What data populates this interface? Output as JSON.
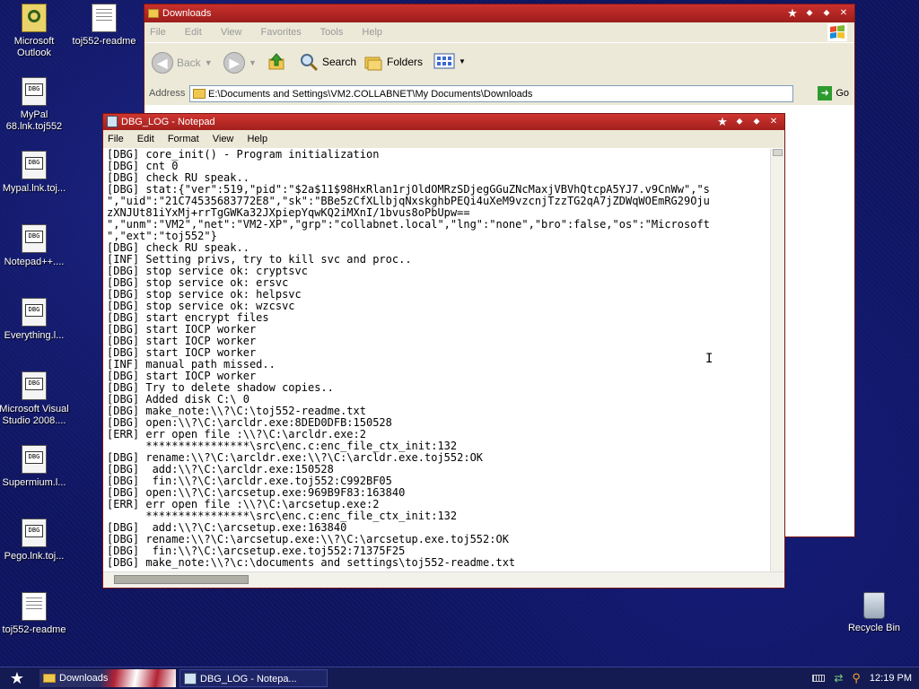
{
  "desktop": {
    "icons": [
      {
        "label": "Microsoft Outlook"
      },
      {
        "label": "toj552-readme"
      },
      {
        "label": "MyPal 68.lnk.toj552"
      },
      {
        "label": "Mypal.lnk.toj..."
      },
      {
        "label": "Notepad++...."
      },
      {
        "label": "Everything.l..."
      },
      {
        "label": "Microsoft Visual Studio 2008...."
      },
      {
        "label": "Supermium.l..."
      },
      {
        "label": "Pego.lnk.toj..."
      },
      {
        "label": "toj552-readme"
      },
      {
        "label": "Recycle Bin"
      }
    ]
  },
  "explorer": {
    "title": "Downloads",
    "menu": [
      "File",
      "Edit",
      "View",
      "Favorites",
      "Tools",
      "Help"
    ],
    "toolbar": {
      "back_label": "Back",
      "search_label": "Search",
      "folders_label": "Folders"
    },
    "address_label": "Address",
    "address_value": "E:\\Documents and Settings\\VM2.COLLABNET\\My Documents\\Downloads",
    "go_label": "Go"
  },
  "notepad": {
    "title": "DBG_LOG - Notepad",
    "menu": [
      "File",
      "Edit",
      "Format",
      "View",
      "Help"
    ],
    "lines": [
      "[DBG] core_init() - Program initialization",
      "[DBG] cnt 0",
      "[DBG] check RU speak..",
      "[DBG] stat:{\"ver\":519,\"pid\":\"$2a$11$98HxRlan1rjOldOMRzSDjegGGuZNcMaxjVBVhQtcpA5YJ7.v9CnWw\",\"s",
      "\",\"uid\":\"21C74535683772E8\",\"sk\":\"BBe5zCfXLlbjqNxskghbPEQi4uXeM9vzcnjTzzTG2qA7jZDWqWOEmRG29Oju",
      "zXNJUt81iYxMj+rrTgGWKa32JXpiepYqwKQ2iMXnI/1bvus8oPbUpw==",
      "\",\"unm\":\"VM2\",\"net\":\"VM2-XP\",\"grp\":\"collabnet.local\",\"lng\":\"none\",\"bro\":false,\"os\":\"Microsoft",
      "\",\"ext\":\"toj552\"}",
      "[DBG] check RU speak..",
      "[INF] Setting privs, try to kill svc and proc..",
      "[DBG] stop service ok: cryptsvc",
      "[DBG] stop service ok: ersvc",
      "[DBG] stop service ok: helpsvc",
      "[DBG] stop service ok: wzcsvc",
      "[DBG] start encrypt files",
      "[DBG] start IOCP worker",
      "[DBG] start IOCP worker",
      "[DBG] start IOCP worker",
      "[INF] manual path missed..",
      "[DBG] start IOCP worker",
      "[DBG] Try to delete shadow copies..",
      "[DBG] Added disk C:\\ 0",
      "[DBG] make_note:\\\\?\\C:\\toj552-readme.txt",
      "[DBG] open:\\\\?\\C:\\arcldr.exe:8DED0DFB:150528",
      "[ERR] err open file :\\\\?\\C:\\arcldr.exe:2",
      "      ****************\\src\\enc.c:enc_file_ctx_init:132",
      "[DBG] rename:\\\\?\\C:\\arcldr.exe:\\\\?\\C:\\arcldr.exe.toj552:OK",
      "[DBG]  add:\\\\?\\C:\\arcldr.exe:150528",
      "[DBG]  fin:\\\\?\\C:\\arcldr.exe.toj552:C992BF05",
      "[DBG] open:\\\\?\\C:\\arcsetup.exe:969B9F83:163840",
      "[ERR] err open file :\\\\?\\C:\\arcsetup.exe:2",
      "      ****************\\src\\enc.c:enc_file_ctx_init:132",
      "[DBG]  add:\\\\?\\C:\\arcsetup.exe:163840",
      "[DBG] rename:\\\\?\\C:\\arcsetup.exe:\\\\?\\C:\\arcsetup.exe.toj552:OK",
      "[DBG]  fin:\\\\?\\C:\\arcsetup.exe.toj552:71375F25",
      "[DBG] make_note:\\\\?\\c:\\documents and settings\\toj552-readme.txt"
    ]
  },
  "taskbar": {
    "tasks": [
      {
        "label": "Downloads"
      },
      {
        "label": "DBG_LOG - Notepa..."
      }
    ],
    "clock": "12:19 PM"
  },
  "colors": {
    "titlebar_red": "#c9302c",
    "desktop_blue": "#0e1460",
    "taskbar": "#141a52"
  }
}
